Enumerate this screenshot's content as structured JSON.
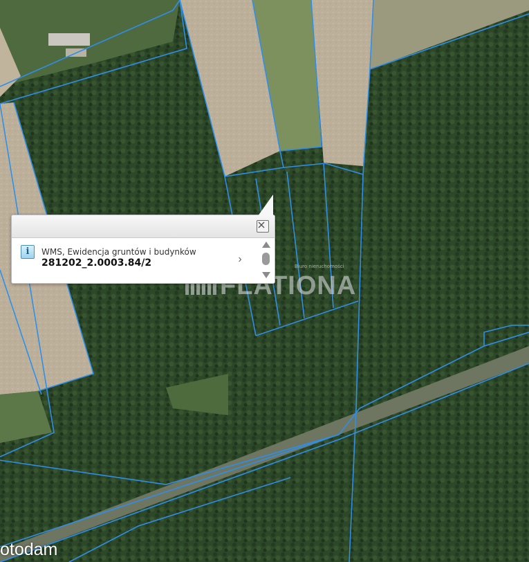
{
  "popup": {
    "layer_name": "WMS, Ewidencja gruntów i budynków",
    "parcel_id": "281202_2.0003.84/2",
    "info_icon_glyph": "i",
    "next_glyph": "›"
  },
  "watermark": {
    "text": "FLATIONA",
    "sub_label": "Biuro nieruchomości"
  },
  "brand": {
    "name": "otodam"
  },
  "colors": {
    "parcel_lines": "#2f8fe8",
    "forest": "#2c4527",
    "field": "#bcae96"
  }
}
